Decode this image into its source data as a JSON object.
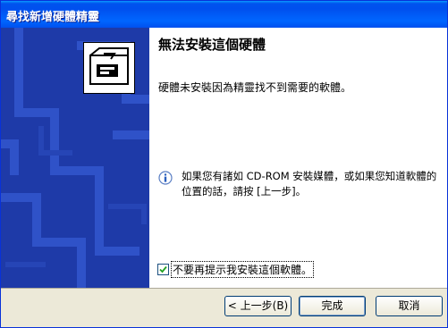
{
  "window": {
    "title": "尋找新增硬體精靈"
  },
  "page": {
    "heading": "無法安裝這個硬體",
    "message": "硬體未安裝因為精靈找不到需要的軟體。",
    "info_text": "如果您有諸如 CD-ROM 安裝媒體，或如果您知道軟體的位置的話，請按 [上一步]。",
    "checkbox_label": "不要再提示我安裝這個軟體。",
    "checkbox_checked": true
  },
  "buttons": {
    "back": "< 上一步(B)",
    "finish": "完成",
    "cancel": "取消"
  },
  "colors": {
    "titlebar": "#0054e3",
    "sidebar": "#1e3aa8",
    "sidebar_pattern": "#2b4dbf"
  },
  "icons": {
    "wizard_hardware": "hardware-install-icon",
    "info": "info-icon"
  }
}
